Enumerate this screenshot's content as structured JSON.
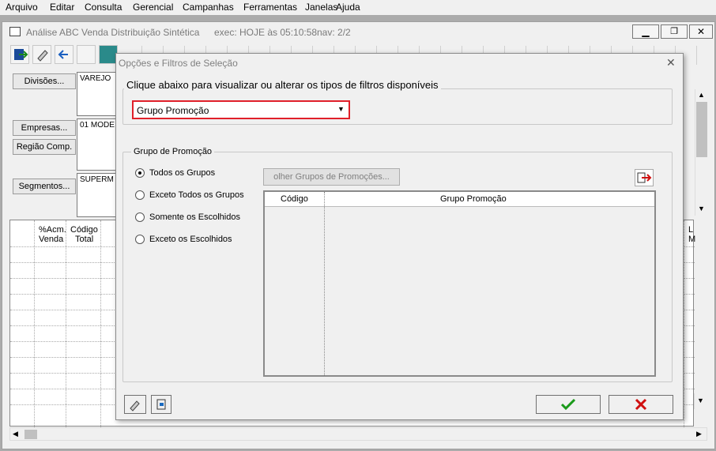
{
  "menu": [
    "Arquivo",
    "Editar",
    "Consulta",
    "Gerencial",
    "Campanhas",
    "Ferramentas",
    "Janelas",
    "Ajuda"
  ],
  "child_window": {
    "title": "Análise ABC Venda Distribuição Sintética",
    "exec": "exec: HOJE às 05:10:58",
    "nav": "nav: 2/2"
  },
  "sidebar": {
    "divisoes": "Divisões...",
    "empresas": "Empresas...",
    "regiao": "Região Comp.",
    "segmentos": "Segmentos...",
    "box1": "VAREJO",
    "box2": "01 MODE",
    "box3": "SUPERM"
  },
  "grid": {
    "col1": "%Acm.",
    "col1b": "Venda",
    "col2": "Código",
    "col2b": "Total",
    "right_col": "L",
    "right_col_b": "M"
  },
  "dialog": {
    "title": "Opções e Filtros de Seleção",
    "close": "✕",
    "group_title": "Clique abaixo para visualizar ou alterar os tipos de filtros disponíveis",
    "dropdown_value": "Grupo Promoção",
    "sub_group_title": "Grupo de Promoção",
    "radios": [
      "Todos os Grupos",
      "Exceto Todos os Grupos",
      "Somente os Escolhidos",
      "Exceto os Escolhidos"
    ],
    "selected_index": 0,
    "choose_button": "olher Grupos de Promoções...",
    "table_headers": [
      "Código",
      "Grupo Promoção"
    ]
  },
  "colors": {
    "highlight": "#e0202a",
    "ok": "#1a9a1a",
    "cancel": "#d01010"
  }
}
